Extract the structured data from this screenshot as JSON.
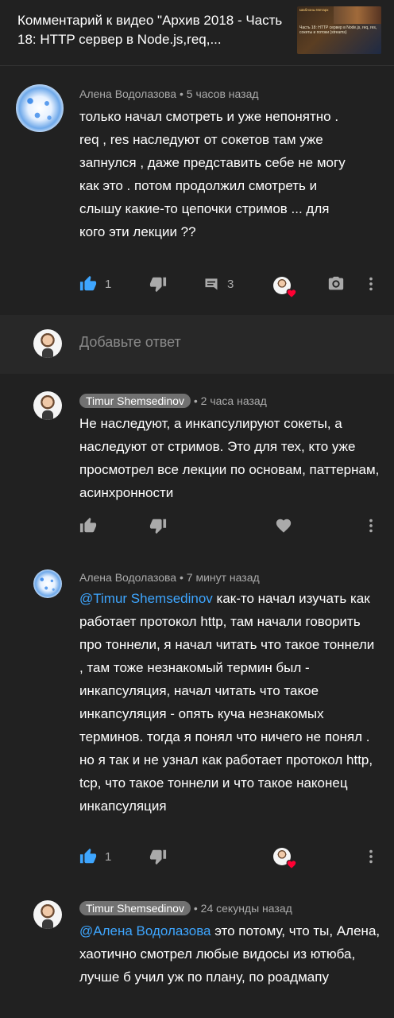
{
  "header": {
    "title": "Комментарий к видео \"Архив 2018 - Часть 18: HTTP сервер в Node.js,req,...",
    "thumbnail_caption": "Часть 18: HTTP сервер в Node.js, req, res, сокеты и потоки (streams)",
    "thumbnail_small": "Шаблоны Метарх"
  },
  "comments": [
    {
      "author": "Алена Водолазова",
      "time": "5 часов назад",
      "text": "только начал смотреть и уже непонятно .  req , res наследуют от сокетов там уже запнулся , даже представить себе не могу как это . потом продолжил смотреть и слышу какие-то цепочки стримов ... для кого эти лекции ??",
      "likes": "1",
      "replies": "3"
    },
    {
      "author": "Timur Shemsedinov",
      "time": "2 часа назад",
      "text": "Не наследуют, а инкапсулируют сокеты, а наследуют от стримов. Это для тех, кто уже просмотрел все лекции по основам, паттернам, асинхронности"
    },
    {
      "author": "Алена Водолазова",
      "time": "7 минут назад",
      "mention": "@Timur Shemsedinov",
      "text": " как-то начал изучать как работает протокол http, там начали говорить про тоннели, я начал читать что такое тоннели , там тоже незнакомый термин был - инкапсуляция, начал читать что такое инкапсуляция - опять куча незнакомых терминов. тогда я понял что ничего не понял . но я так и не узнал как работает протокол http, tcp, что такое тоннели и что такое наконец инкапсуляция",
      "likes": "1"
    },
    {
      "author": "Timur Shemsedinov",
      "time": "24 секунды назад",
      "mention": "@Алена Водолазова",
      "text": " это потому, что ты, Алена, хаотично смотрел любые видосы из ютюба, лучше б учил уж по плану, по роадмапу"
    }
  ],
  "reply": {
    "placeholder": "Добавьте ответ"
  },
  "separator": "•",
  "colors": {
    "background": "#212121",
    "reply_area": "#282828",
    "like_active": "#3ea6ff",
    "mention": "#3ea6ff",
    "heart": "#ff0033",
    "badge": "#717171"
  }
}
